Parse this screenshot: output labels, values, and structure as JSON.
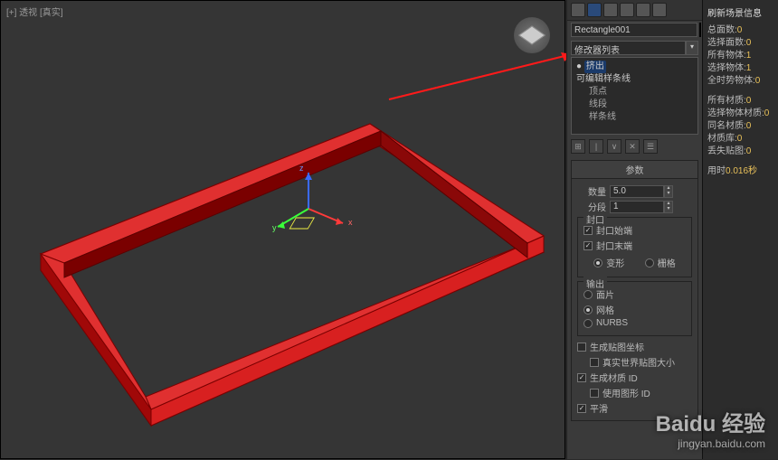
{
  "viewport": {
    "label": "[+] 透视 [真实]",
    "axes": {
      "x": "x",
      "y": "y",
      "z": "z"
    }
  },
  "command_panel": {
    "object_name": "Rectangle001",
    "modifier_dropdown": "修改器列表",
    "stack": {
      "top": "挤出",
      "base": "可编辑样条线",
      "subs": [
        "顶点",
        "线段",
        "样条线"
      ]
    },
    "stack_buttons": [
      "⊞",
      "|",
      "∨",
      "✕",
      "☰"
    ]
  },
  "params": {
    "title": "参数",
    "amount_label": "数量",
    "amount_value": "5.0",
    "segments_label": "分段",
    "segments_value": "1"
  },
  "capping": {
    "title": "封口",
    "cap_start": "封口始端",
    "cap_end": "封口末端",
    "morph": "变形",
    "grid": "栅格"
  },
  "output": {
    "title": "输出",
    "patch": "面片",
    "mesh": "网格",
    "nurbs": "NURBS"
  },
  "mapping": {
    "gen_coords": "生成贴图坐标",
    "real_world": "真实世界贴图大小",
    "gen_ids": "生成材质 ID",
    "use_ids": "使用图形 ID",
    "smooth": "平滑"
  },
  "scene_info": {
    "title": "刷新场景信息",
    "rows": [
      {
        "k": "总面数:",
        "v": "0"
      },
      {
        "k": "选择面数:",
        "v": "0"
      },
      {
        "k": "所有物体:",
        "v": "1"
      },
      {
        "k": "选择物体:",
        "v": "1"
      },
      {
        "k": "全时势物体:",
        "v": "0"
      }
    ],
    "rows2": [
      {
        "k": "所有材质:",
        "v": "0"
      },
      {
        "k": "选择物体材质:",
        "v": "0"
      },
      {
        "k": "同名材质:",
        "v": "0"
      },
      {
        "k": "材质库:",
        "v": "0"
      },
      {
        "k": "丢失贴图:",
        "v": "0"
      }
    ],
    "time": {
      "k": "用时",
      "v": "0.016秒"
    }
  },
  "watermark": {
    "brand": "Baidu 经验",
    "url": "jingyan.baidu.com"
  }
}
